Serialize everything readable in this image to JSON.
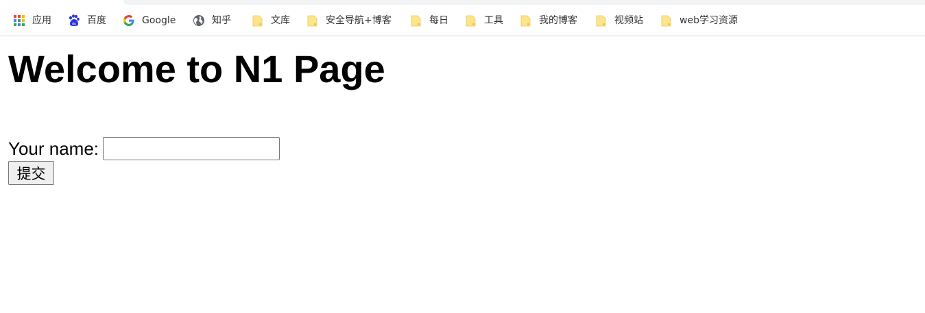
{
  "bookmarks_bar": {
    "items": [
      {
        "label": "应用",
        "icon": "apps-grid-icon"
      },
      {
        "label": "百度",
        "icon": "baidu-paw-icon"
      },
      {
        "label": "Google",
        "icon": "google-g-icon"
      },
      {
        "label": "知乎",
        "icon": "globe-icon"
      },
      {
        "label": "文库",
        "icon": "folder-icon"
      },
      {
        "label": "安全导航+博客",
        "icon": "folder-icon"
      },
      {
        "label": "每日",
        "icon": "folder-icon"
      },
      {
        "label": "工具",
        "icon": "folder-icon"
      },
      {
        "label": "我的博客",
        "icon": "folder-icon"
      },
      {
        "label": "视频站",
        "icon": "folder-icon"
      },
      {
        "label": "web学习资源",
        "icon": "folder-icon"
      }
    ]
  },
  "page": {
    "heading": "Welcome to N1 Page",
    "form": {
      "name_label": "Your name:",
      "name_value": "",
      "submit_label": "提交"
    }
  },
  "colors": {
    "folder": "#fde58c",
    "baidu": "#2932e1",
    "text": "#000000"
  }
}
